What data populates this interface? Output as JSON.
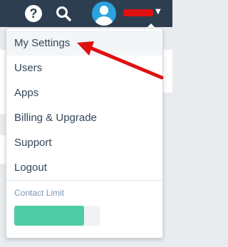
{
  "header": {
    "help_glyph": "?",
    "chevron_glyph": "▼"
  },
  "menu": {
    "items": [
      {
        "label": "My Settings"
      },
      {
        "label": "Users"
      },
      {
        "label": "Apps"
      },
      {
        "label": "Billing & Upgrade"
      },
      {
        "label": "Support"
      },
      {
        "label": "Logout"
      }
    ],
    "contact_limit_label": "Contact Limit",
    "contact_limit_fill_fraction": 0.82
  },
  "colors": {
    "header_bg": "#2d3e50",
    "avatar": "#2aa3de",
    "limit_fill": "#4fcca6",
    "annotation": "#e01010"
  },
  "icons": [
    "help-icon",
    "search-icon",
    "avatar",
    "chevron-down-icon"
  ]
}
